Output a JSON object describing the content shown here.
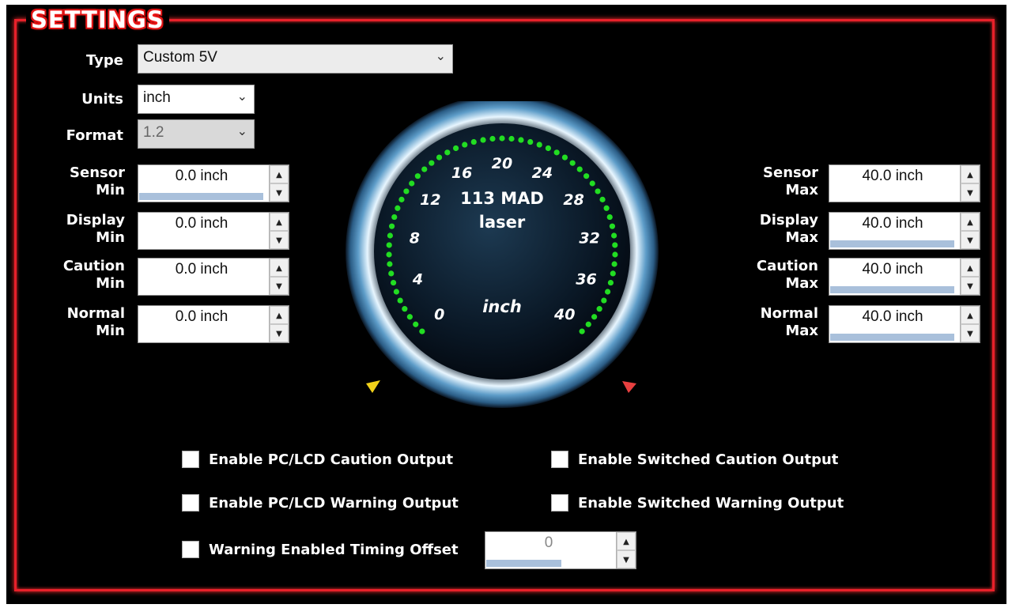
{
  "title": "SETTINGS",
  "type": {
    "label": "Type",
    "value": "Custom 5V"
  },
  "units": {
    "label": "Units",
    "value": "inch"
  },
  "format": {
    "label": "Format",
    "value": "1.2"
  },
  "left_fields": [
    {
      "label1": "Sensor",
      "label2": "Min",
      "value": "0.0 inch",
      "fill": 0.98
    },
    {
      "label1": "Display",
      "label2": "Min",
      "value": "0.0 inch",
      "fill": 0
    },
    {
      "label1": "Caution",
      "label2": "Min",
      "value": "0.0 inch",
      "fill": 0
    },
    {
      "label1": "Normal",
      "label2": "Min",
      "value": "0.0 inch",
      "fill": 0
    }
  ],
  "right_fields": [
    {
      "label1": "Sensor",
      "label2": "Max",
      "value": "40.0 inch",
      "fill": 0
    },
    {
      "label1": "Display",
      "label2": "Max",
      "value": "40.0 inch",
      "fill": 0.98
    },
    {
      "label1": "Caution",
      "label2": "Max",
      "value": "40.0 inch",
      "fill": 0.98
    },
    {
      "label1": "Normal",
      "label2": "Max",
      "value": "40.0 inch",
      "fill": 0.98
    }
  ],
  "gauge": {
    "name": "113 MAD",
    "sub": "laser",
    "unit": "inch",
    "ticks": [
      "0",
      "4",
      "8",
      "12",
      "16",
      "20",
      "24",
      "28",
      "32",
      "36",
      "40"
    ],
    "min": 0,
    "max": 40,
    "arc_color": "#22dd22",
    "caution_marker_color": "#f2d21a",
    "warning_marker_color": "#e84040"
  },
  "checkboxes": {
    "pc_caution": "Enable PC/LCD Caution Output",
    "pc_warning": "Enable PC/LCD Warning Output",
    "sw_caution": "Enable Switched Caution Output",
    "sw_warning": "Enable Switched Warning Output",
    "timing_offset": "Warning Enabled Timing Offset"
  },
  "timing_offset_value": "0",
  "colors": {
    "frame": "#e8202a",
    "background": "#000000"
  }
}
